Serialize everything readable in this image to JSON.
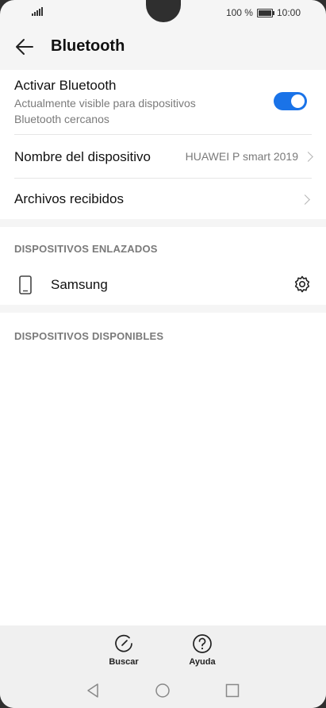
{
  "status": {
    "battery": "100 %",
    "time": "10:00"
  },
  "header": {
    "title": "Bluetooth",
    "back_icon": "arrow-left-icon"
  },
  "bluetooth": {
    "label": "Activar Bluetooth",
    "sub_line1": "Actualmente visible para dispositivos",
    "sub_line2": "Bluetooth cercanos",
    "enabled": true,
    "accent": "#1a73e8"
  },
  "device_name": {
    "label": "Nombre del dispositivo",
    "value": "HUAWEI P smart 2019"
  },
  "received_files": {
    "label": "Archivos recibidos"
  },
  "paired": {
    "header": "DISPOSITIVOS ENLAZADOS",
    "devices": [
      {
        "name": "Samsung",
        "icon": "phone-icon",
        "settings_icon": "gear-icon"
      }
    ]
  },
  "available": {
    "header": "DISPOSITIVOS DISPONIBLES"
  },
  "bottom_actions": {
    "search_label": "Buscar",
    "help_label": "Ayuda"
  }
}
